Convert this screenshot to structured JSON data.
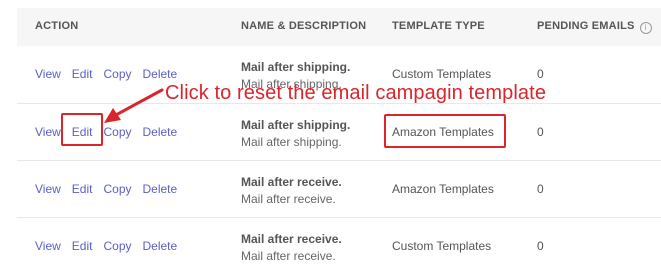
{
  "header": {
    "action": "ACTION",
    "name_desc": "NAME & DESCRIPTION",
    "template_type": "TEMPLATE TYPE",
    "pending_emails": "PENDING EMAILS",
    "info_icon_glyph": "i"
  },
  "rows": [
    {
      "actions": [
        "View",
        "Edit",
        "Copy",
        "Delete"
      ],
      "title": "Mail after shipping.",
      "desc": "Mail after shipping.",
      "type": "Custom Templates",
      "pending": "0"
    },
    {
      "actions": [
        "View",
        "Edit",
        "Copy",
        "Delete"
      ],
      "title": "Mail after shipping.",
      "desc": "Mail after shipping.",
      "type": "Amazon Templates",
      "pending": "0"
    },
    {
      "actions": [
        "View",
        "Edit",
        "Copy",
        "Delete"
      ],
      "title": "Mail after receive.",
      "desc": "Mail after receive.",
      "type": "Amazon Templates",
      "pending": "0"
    },
    {
      "actions": [
        "View",
        "Edit",
        "Copy",
        "Delete"
      ],
      "title": "Mail after receive.",
      "desc": "Mail after receive.",
      "type": "Custom Templates",
      "pending": "0"
    }
  ],
  "annotation": {
    "text": "Click to reset the email campagin template",
    "color": "#d9252b"
  },
  "colors": {
    "link": "#5b5fc7",
    "header_bg": "#f6f6f6",
    "highlight": "#d9252b"
  }
}
